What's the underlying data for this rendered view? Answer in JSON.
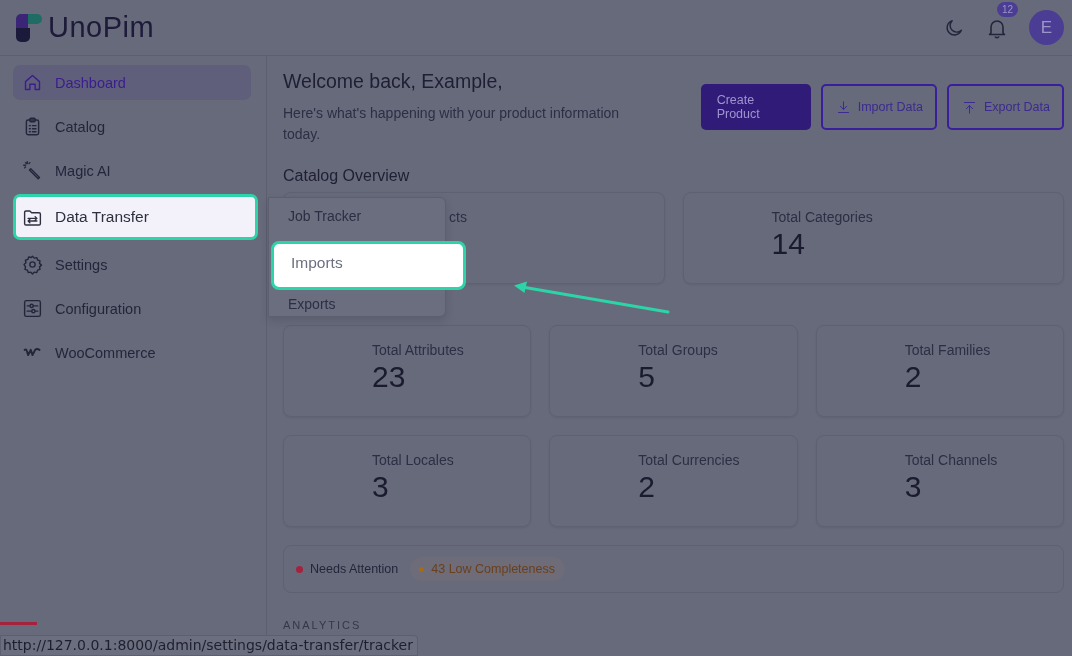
{
  "logo": {
    "text": "UnoPim"
  },
  "header": {
    "notification_count": "12",
    "avatar_initial": "E"
  },
  "sidebar": {
    "items": [
      {
        "label": "Dashboard",
        "selected": true,
        "highlighted": false
      },
      {
        "label": "Catalog",
        "selected": false,
        "highlighted": false
      },
      {
        "label": "Magic AI",
        "selected": false,
        "highlighted": false
      },
      {
        "label": "Data Transfer",
        "selected": false,
        "highlighted": true
      },
      {
        "label": "Settings",
        "selected": false,
        "highlighted": false
      },
      {
        "label": "Configuration",
        "selected": false,
        "highlighted": false
      },
      {
        "label": "WooCommerce",
        "selected": false,
        "highlighted": false
      }
    ]
  },
  "submenu": {
    "items": [
      {
        "label": "Job Tracker",
        "highlighted": false
      },
      {
        "label": "Imports",
        "highlighted": true
      },
      {
        "label": "Exports",
        "highlighted": false
      }
    ]
  },
  "welcome": {
    "title": "Welcome back, Example,",
    "subtitle": "Here's what's happening with your product information today."
  },
  "actions": [
    {
      "label": "Create Product",
      "kind": "primary"
    },
    {
      "label": "Import Data",
      "kind": "import"
    },
    {
      "label": "Export Data",
      "kind": "export"
    }
  ],
  "catalog_overview": {
    "title": "Catalog Overview",
    "rows": [
      [
        {
          "label": "cts"
        },
        {
          "label": "Total Categories",
          "value": "14"
        }
      ],
      [
        {
          "label": "Total Attributes",
          "value": "23"
        },
        {
          "label": "Total Groups",
          "value": "5"
        },
        {
          "label": "Total Families",
          "value": "2"
        }
      ],
      [
        {
          "label": "Total Locales",
          "value": "3"
        },
        {
          "label": "Total Currencies",
          "value": "2"
        },
        {
          "label": "Total Channels",
          "value": "3"
        }
      ]
    ]
  },
  "alerts": [
    {
      "label": "Needs Attention",
      "color": "#a3233f",
      "kind": "plain"
    },
    {
      "label": "43 Low Completeness",
      "color": "#a86b12",
      "kind": "pill"
    }
  ],
  "analytics_heading": "ANALYTICS",
  "status_url": "http://127.0.0.1:8000/admin/settings/data-transfer/tracker"
}
